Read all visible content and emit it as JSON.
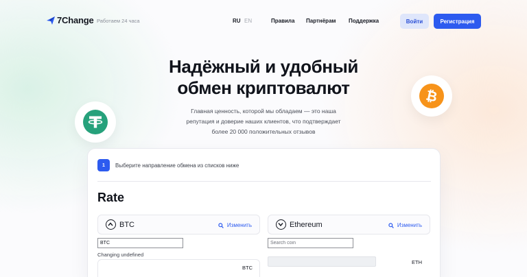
{
  "header": {
    "logo_text": "7Change",
    "tagline": "Работаем 24 часа",
    "lang_ru": "RU",
    "lang_en": "EN",
    "nav": [
      "Правила",
      "Партнёрам",
      "Поддержка"
    ],
    "login_label": "Войти",
    "register_label": "Регистрация"
  },
  "hero": {
    "title_line1": "Надёжный и удобный",
    "title_line2": "обмен криптовалют",
    "subtitle_line1": "Главная ценность, которой мы обладаем — это наша",
    "subtitle_line2": "репутация и доверие наших клиентов, что подтверждает",
    "subtitle_line3": "более 20 000 положительных отзывов"
  },
  "exchange": {
    "step_number": "1",
    "step_text": "Выберите направление обмена из списков ниже",
    "rate_title": "Rate",
    "from": {
      "coin": "BTC",
      "change_label": "Изменить",
      "input_value": "BTC",
      "changing_label": "Changing undefined",
      "currency": "BTC"
    },
    "to": {
      "coin": "Ethereum",
      "change_label": "Изменить",
      "input_placeholder": "Search coin",
      "currency": "ETH"
    }
  },
  "colors": {
    "accent": "#2d5bef",
    "tether": "#26a17b",
    "bitcoin": "#f7931a"
  },
  "icons": [
    "logo-icon",
    "tether-icon",
    "bitcoin-icon",
    "chevron-up-icon",
    "chevron-down-icon",
    "search-icon"
  ]
}
